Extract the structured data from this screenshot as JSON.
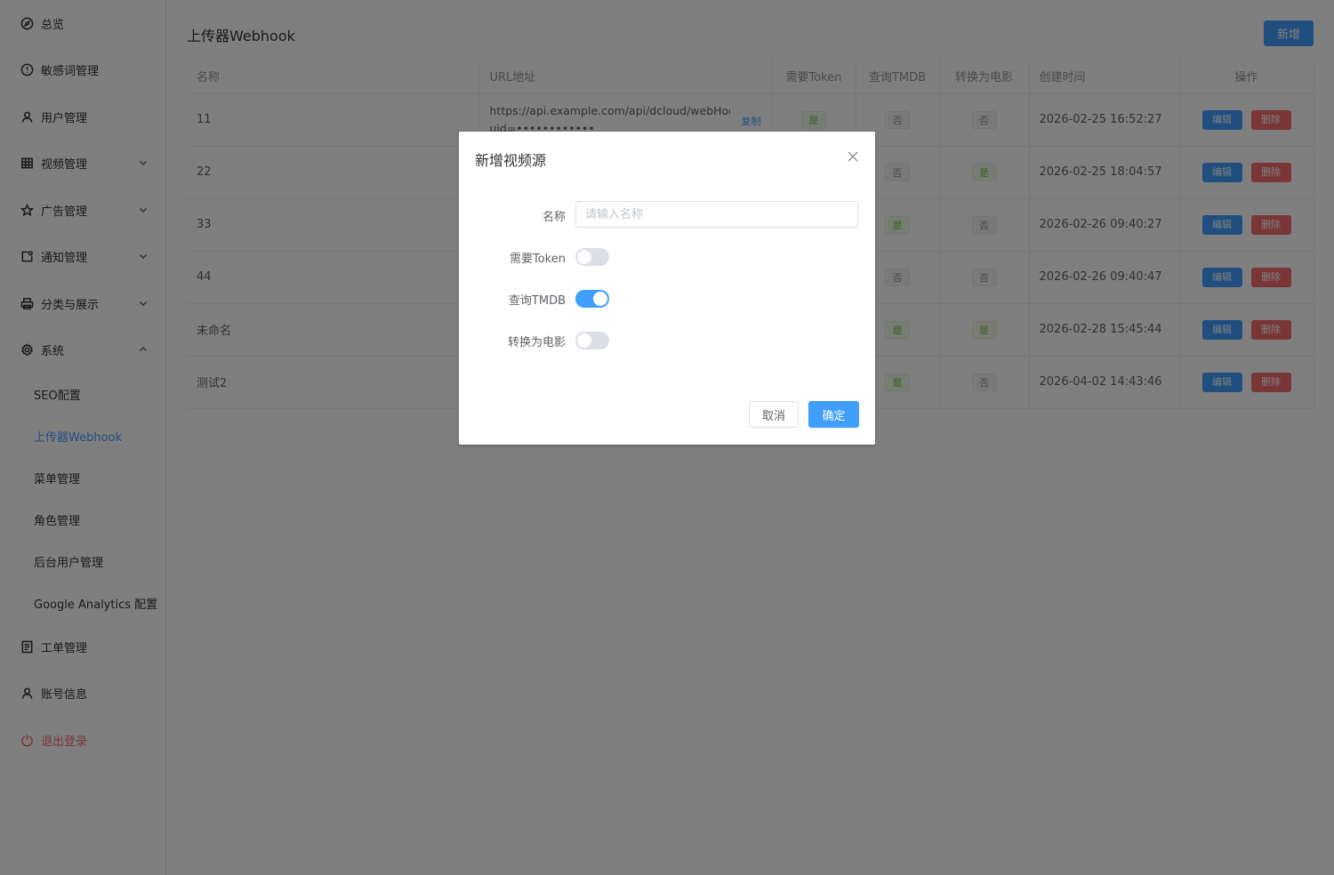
{
  "sidebar": {
    "items": [
      {
        "label": "总览",
        "icon": "compass-icon"
      },
      {
        "label": "敏感词管理",
        "icon": "alert-circle-icon"
      },
      {
        "label": "用户管理",
        "icon": "user-icon"
      },
      {
        "label": "视频管理",
        "icon": "grid-icon"
      },
      {
        "label": "广告管理",
        "icon": "star-icon"
      },
      {
        "label": "通知管理",
        "icon": "notification-icon"
      },
      {
        "label": "分类与展示",
        "icon": "printer-icon"
      },
      {
        "label": "系统",
        "icon": "gear-icon"
      }
    ],
    "sub_items": [
      {
        "label": "SEO配置"
      },
      {
        "label": "上传器Webhook"
      },
      {
        "label": "菜单管理"
      },
      {
        "label": "角色管理"
      },
      {
        "label": "后台用户管理"
      },
      {
        "label": "Google Analytics 配置"
      }
    ],
    "bottom_items": [
      {
        "label": "工单管理",
        "icon": "document-icon"
      },
      {
        "label": "账号信息",
        "icon": "user-icon"
      },
      {
        "label": "退出登录",
        "icon": "power-icon"
      }
    ]
  },
  "page": {
    "title": "上传器Webhook",
    "add_label": "新增"
  },
  "table": {
    "headers": [
      "名称",
      "URL地址",
      "需要Token",
      "查询TMDB",
      "转换为电影",
      "创建时间",
      "操作"
    ],
    "copy_label": "复制",
    "edit_label": "编辑",
    "delete_label": "删除",
    "yes_label": "是",
    "no_label": "否",
    "rows": [
      {
        "name": "11",
        "url": "https://api.example.com/api/dcloud/webHook?uid=••••••••••••",
        "token": "是",
        "tmdb": "否",
        "movie": "否",
        "created": "2026-02-25 16:52:27"
      },
      {
        "name": "22",
        "url": "",
        "token": "",
        "tmdb": "否",
        "movie": "是",
        "created": "2026-02-25 18:04:57"
      },
      {
        "name": "33",
        "url": "",
        "token": "",
        "tmdb": "是",
        "movie": "否",
        "created": "2026-02-26 09:40:27"
      },
      {
        "name": "44",
        "url": "",
        "token": "",
        "tmdb": "否",
        "movie": "否",
        "created": "2026-02-26 09:40:47"
      },
      {
        "name": "未命名",
        "url": "",
        "token": "",
        "tmdb": "是",
        "movie": "是",
        "created": "2026-02-28 15:45:44"
      },
      {
        "name": "测试2",
        "url": "",
        "token": "",
        "tmdb": "是",
        "movie": "否",
        "created": "2026-04-02 14:43:46"
      }
    ]
  },
  "dialog": {
    "title": "新增视频源",
    "name_label": "名称",
    "name_placeholder": "请输入名称",
    "name_value": "",
    "token_label": "需要Token",
    "token_on": false,
    "tmdb_label": "查询TMDB",
    "tmdb_on": true,
    "movie_label": "转换为电影",
    "movie_on": false,
    "cancel_label": "取消",
    "ok_label": "确定"
  },
  "colors": {
    "primary": "#409eff",
    "danger": "#f56c6c",
    "success": "#67c23a"
  }
}
